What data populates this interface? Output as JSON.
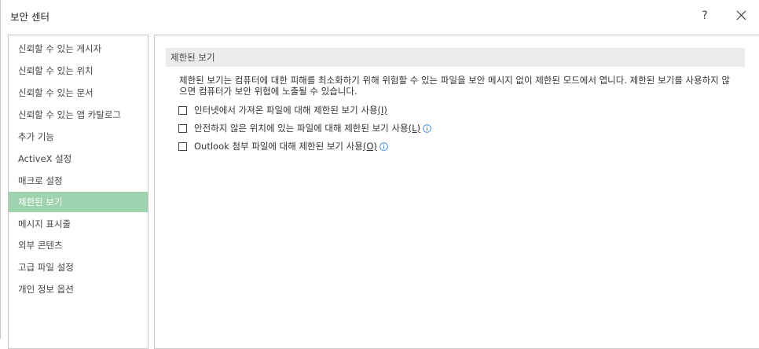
{
  "window": {
    "title": "보안 센터",
    "help_label": "?"
  },
  "sidebar": {
    "items": [
      {
        "label": "신뢰할 수 있는 게시자"
      },
      {
        "label": "신뢰할 수 있는 위치"
      },
      {
        "label": "신뢰할 수 있는 문서"
      },
      {
        "label": "신뢰할 수 있는 앱 카탈로그"
      },
      {
        "label": "추가 기능"
      },
      {
        "label": "ActiveX 설정"
      },
      {
        "label": "매크로 설정"
      },
      {
        "label": "제한된 보기"
      },
      {
        "label": "메시지 표시줄"
      },
      {
        "label": "외부 콘텐츠"
      },
      {
        "label": "고급 파일 설정"
      },
      {
        "label": "개인 정보 옵션"
      }
    ],
    "selected": "제한된 보기"
  },
  "main": {
    "section_title": "제한된 보기",
    "description": "제한된 보기는 컴퓨터에 대한 피해를 최소화하기 위해 위험할 수 있는 파일을 보안 메시지 없이 제한된 모드에서 엽니다. 제한된 보기를 사용하지 않으면 컴퓨터가 보안 위협에 노출될 수 있습니다.",
    "options": [
      {
        "label": "인터넷에서 가져온 파일에 대해 제한된 보기 사용",
        "key": "(I)",
        "checked": false,
        "info": false
      },
      {
        "label": "안전하지 않은 위치에 있는 파일에 대해 제한된 보기 사용",
        "key": "(L)",
        "checked": false,
        "info": true
      },
      {
        "label": "Outlook 첨부 파일에 대해 제한된 보기 사용",
        "key": "(O)",
        "checked": false,
        "info": true
      }
    ]
  },
  "colors": {
    "selected_bg": "#9fd3b0",
    "info_icon": "#2b7cd3",
    "header_bg": "#ececec"
  }
}
